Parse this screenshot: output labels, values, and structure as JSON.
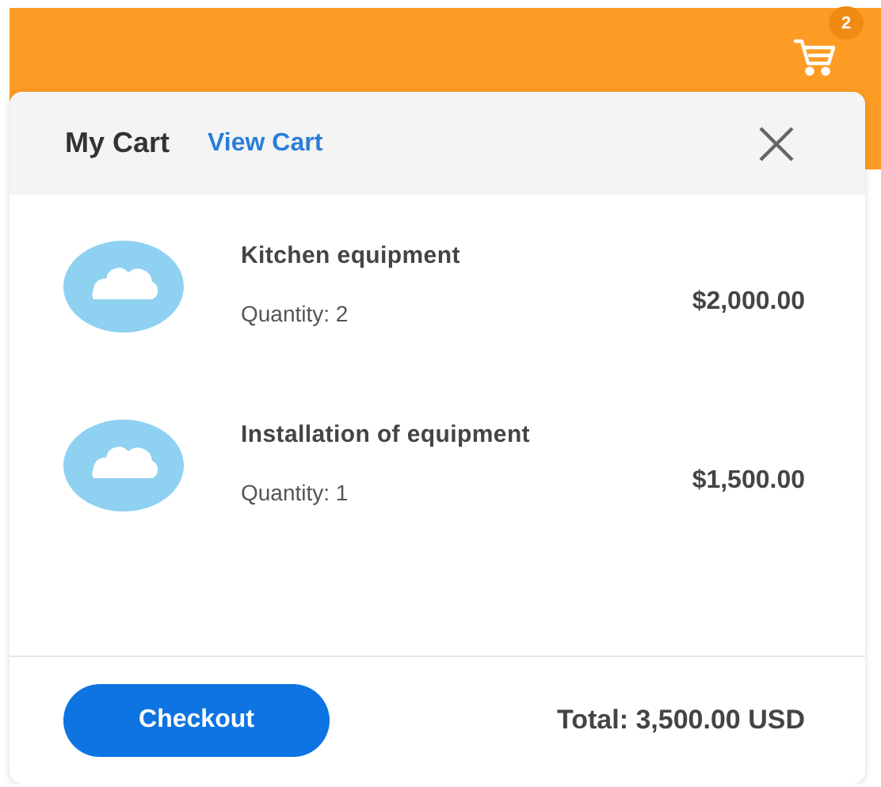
{
  "header": {
    "cart_count": "2"
  },
  "cart": {
    "title": "My Cart",
    "view_link": "View Cart",
    "items": [
      {
        "name": "Kitchen equipment",
        "quantity": "Quantity: 2",
        "price": "$2,000.00"
      },
      {
        "name": "Installation of equipment",
        "quantity": "Quantity: 1",
        "price": "$1,500.00"
      }
    ],
    "checkout": "Checkout",
    "total": "Total: 3,500.00 USD"
  }
}
